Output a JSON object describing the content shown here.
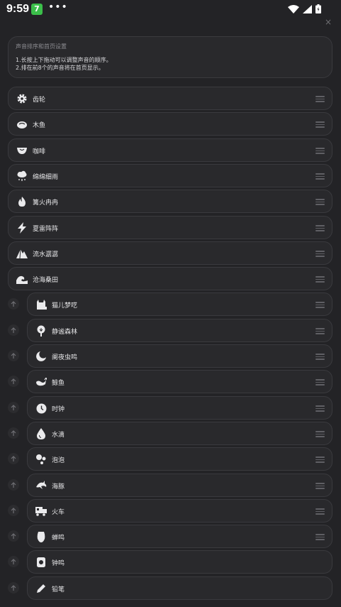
{
  "status_bar": {
    "time": "9:59",
    "app_badge": "7",
    "more": "•••"
  },
  "dialog": {
    "close_symbol": "×"
  },
  "info": {
    "title": "声音排序和首页设置",
    "line1": "1.长按上下拖动可以调整声音的顺序。",
    "line2": "2.排在前8个的声音将在首页显示。"
  },
  "sounds": [
    {
      "label": "齿轮",
      "icon": "gear-icon"
    },
    {
      "label": "木鱼",
      "icon": "wooden-fish-icon"
    },
    {
      "label": "咖啡",
      "icon": "coffee-icon"
    },
    {
      "label": "绵绵细雨",
      "icon": "rain-cloud-icon"
    },
    {
      "label": "篝火冉冉",
      "icon": "fire-icon"
    },
    {
      "label": "夏雷阵阵",
      "icon": "lightning-icon"
    },
    {
      "label": "流水潺潺",
      "icon": "stream-icon"
    },
    {
      "label": "沧海桑田",
      "icon": "wave-icon"
    },
    {
      "label": "猫儿梦呓",
      "icon": "cat-bed-icon"
    },
    {
      "label": "静谧森林",
      "icon": "tree-icon"
    },
    {
      "label": "阑夜虫鸣",
      "icon": "moon-icon"
    },
    {
      "label": "鲸鱼",
      "icon": "whale-icon"
    },
    {
      "label": "时钟",
      "icon": "clock-icon"
    },
    {
      "label": "水滴",
      "icon": "water-drop-icon"
    },
    {
      "label": "泡泡",
      "icon": "bubbles-icon"
    },
    {
      "label": "海豚",
      "icon": "dolphin-icon"
    },
    {
      "label": "火车",
      "icon": "train-icon"
    },
    {
      "label": "蝉鸣",
      "icon": "cicada-icon"
    },
    {
      "label": "钟鸣",
      "icon": "bell-icon"
    },
    {
      "label": "铅笔",
      "icon": "pencil-icon"
    }
  ],
  "colors": {
    "background": "#232326",
    "card": "#29292c",
    "icon": "#eaeaec",
    "handle": "#5f5f64"
  }
}
